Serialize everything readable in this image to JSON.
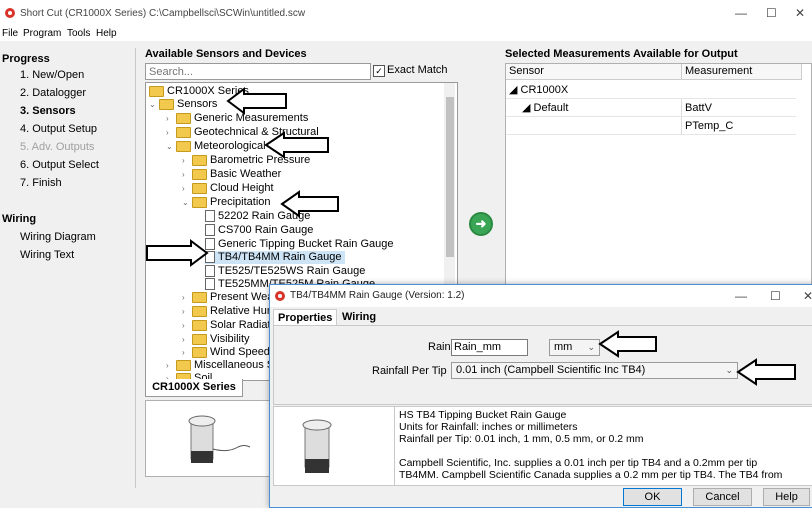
{
  "window": {
    "title": "Short Cut (CR1000X Series) C:\\Campbellsci\\SCWin\\untitled.scw",
    "minimize": "—",
    "maximize": "☐",
    "close": "✕"
  },
  "menu": [
    "File",
    "Program",
    "Tools",
    "Help"
  ],
  "progress": {
    "heading": "Progress",
    "items": [
      "1. New/Open",
      "2. Datalogger",
      "3. Sensors",
      "4. Output Setup",
      "5. Adv. Outputs",
      "6. Output Select",
      "7. Finish"
    ],
    "active": "3. Sensors",
    "disabled": "5. Adv. Outputs"
  },
  "wiring": {
    "heading": "Wiring",
    "items": [
      "Wiring Diagram",
      "Wiring Text"
    ]
  },
  "sensors": {
    "title": "Available Sensors and Devices",
    "search_placeholder": "Search...",
    "exact_match": "Exact Match",
    "tree": [
      "CR1000X Series",
      "Sensors",
      "Generic Measurements",
      "Geotechnical & Structural",
      "Meteorological",
      "Barometric Pressure",
      "Basic Weather",
      "Cloud Height",
      "Precipitation",
      "52202 Rain Gauge",
      "CS700 Rain Gauge",
      "Generic Tipping Bucket Rain Gauge",
      "TB4/TB4MM Rain Gauge",
      "TE525/TE525WS Rain Gauge",
      "TE525MM/TE525M Rain Gauge",
      "Present Wea",
      "Relative Hum",
      "Solar Radiati",
      "Visibility",
      "Wind Speed",
      "Miscellaneous S",
      "Soil"
    ],
    "tab": "CR1000X Series"
  },
  "selected": {
    "title": "Selected Measurements Available for Output",
    "columns": [
      "Sensor",
      "Measurement"
    ],
    "rows": [
      [
        "CR1000X",
        ""
      ],
      [
        "Default",
        "BattV"
      ],
      [
        "",
        "PTemp_C"
      ]
    ]
  },
  "dialog": {
    "title": "TB4/TB4MM Rain Gauge (Version: 1.2)",
    "tabs": [
      "Properties",
      "Wiring"
    ],
    "rain_label": "Rain",
    "rain_value": "Rain_mm",
    "rain_unit": "mm",
    "tip_label": "Rainfall Per Tip",
    "tip_value": "0.01 inch (Campbell Scientific Inc TB4)",
    "desc": [
      "HS TB4 Tipping Bucket Rain Gauge",
      "Units for Rainfall: inches or millimeters",
      "Rainfall per Tip: 0.01 inch, 1 mm, 0.5 mm, or 0.2 mm",
      "",
      "Campbell Scientific, Inc. supplies a 0.01 inch per tip TB4 and a 0.2mm per tip",
      "TB4MM. Campbell Scientific Canada supplies a 0.2 mm per tip TB4. The TB4 from"
    ],
    "buttons": [
      "OK",
      "Cancel",
      "Help"
    ],
    "minimize": "—",
    "maximize": "☐",
    "close": "✕"
  },
  "colors": {
    "accent": "#0078d7",
    "selection": "#cde4f7",
    "go_button": "#3aa655"
  }
}
